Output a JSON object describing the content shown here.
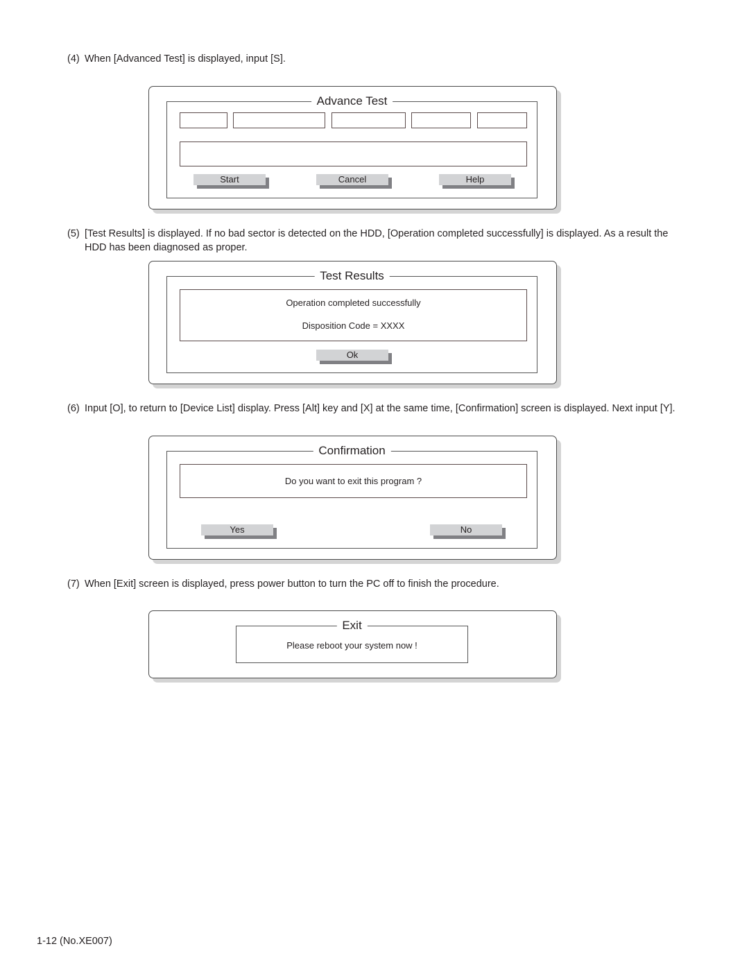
{
  "steps": [
    {
      "num": "(4)",
      "text": "When [Advanced Test] is displayed, input [S]."
    },
    {
      "num": "(5)",
      "text": "[Test Results] is displayed. If no bad sector is detected on the HDD, [Operation completed successfully] is displayed. As a result the HDD has been diagnosed as proper."
    },
    {
      "num": "(6)",
      "text": "Input [O], to return to [Device List] display. Press [Alt] key and [X] at the same time, [Confirmation] screen is displayed. Next input [Y]."
    },
    {
      "num": "(7)",
      "text": "When [Exit] screen is displayed, press power button to turn the PC off to finish the procedure."
    }
  ],
  "advance_test": {
    "title": "Advance Test",
    "buttons": {
      "start": "Start",
      "cancel": "Cancel",
      "help": "Help"
    }
  },
  "test_results": {
    "title": "Test Results",
    "message": "Operation completed successfully",
    "disposition": "Disposition Code  =  XXXX",
    "ok": "Ok"
  },
  "confirmation": {
    "title": "Confirmation",
    "message": "Do you want to exit this program ?",
    "yes": "Yes",
    "no": "No"
  },
  "exit": {
    "title": "Exit",
    "message": "Please reboot your system now !"
  },
  "footer": "1-12 (No.XE007)"
}
